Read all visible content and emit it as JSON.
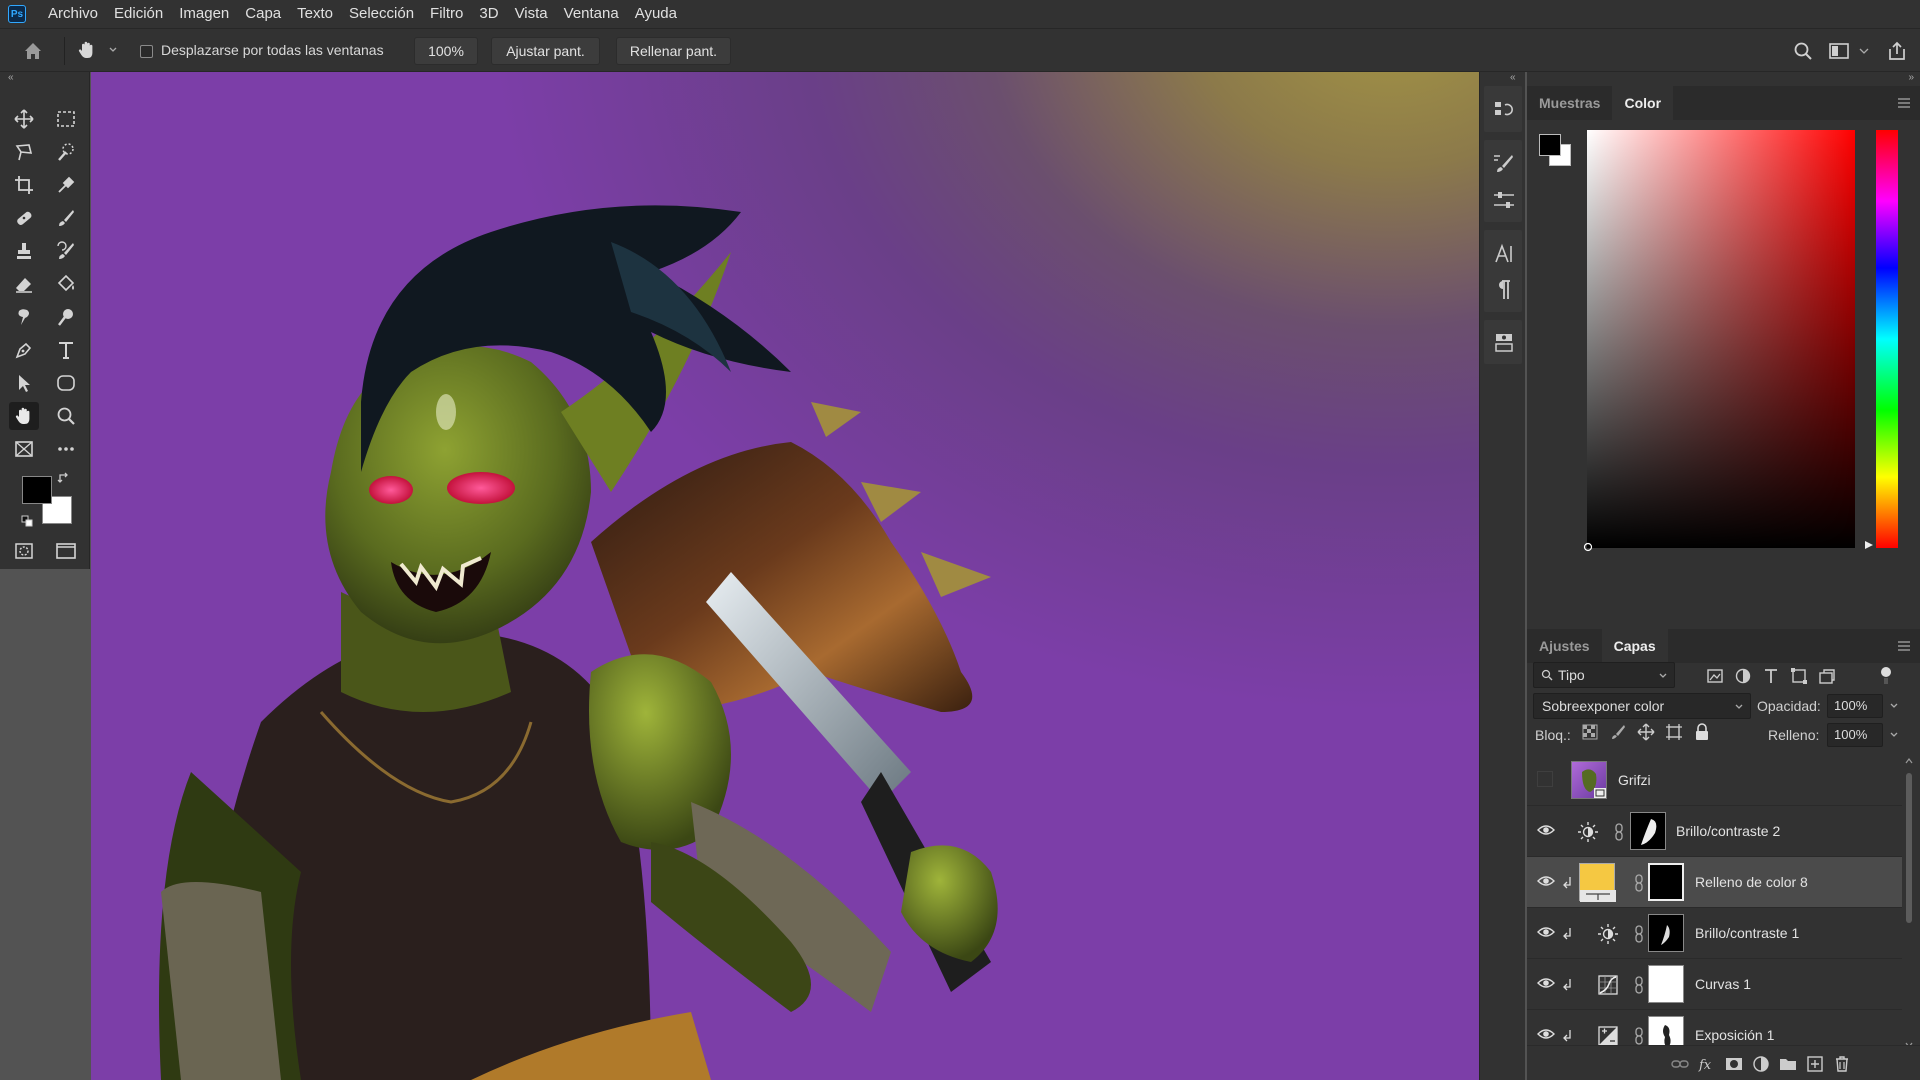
{
  "menu": {
    "items": [
      "Archivo",
      "Edición",
      "Imagen",
      "Capa",
      "Texto",
      "Selección",
      "Filtro",
      "3D",
      "Vista",
      "Ventana",
      "Ayuda"
    ]
  },
  "options": {
    "scroll_all_label": "Desplazarse por todas las ventanas",
    "scroll_all_checked": false,
    "zoom_value": "100%",
    "fit_screen": "Ajustar pant.",
    "fill_screen": "Rellenar pant."
  },
  "toolbar": {
    "active_tool": "hand-tool",
    "foreground_color": "#000000",
    "background_color": "#ffffff"
  },
  "color_panel": {
    "tabs": [
      "Muestras",
      "Color"
    ],
    "active_tab": "Color",
    "foreground": "#000000",
    "background": "#ffffff",
    "hue_color": "#ff0000"
  },
  "layers_panel": {
    "tabs": [
      "Ajustes",
      "Capas"
    ],
    "active_tab": "Capas",
    "filter": "Tipo",
    "blend_mode": "Sobreexponer color",
    "opacity_label": "Opacidad:",
    "opacity": "100%",
    "lock_label": "Bloq.:",
    "fill_label": "Relleno:",
    "fill": "100%",
    "layers": [
      {
        "name": "Grifzi",
        "visible": false,
        "type": "smart-object",
        "clipped": false,
        "selected": false
      },
      {
        "name": "Brillo/contraste 2",
        "visible": true,
        "type": "brightness-contrast",
        "clipped": false,
        "selected": false
      },
      {
        "name": "Relleno de color 8",
        "visible": true,
        "type": "color-fill",
        "clipped": true,
        "selected": true,
        "fill_color": "#f5c842"
      },
      {
        "name": "Brillo/contraste 1",
        "visible": true,
        "type": "brightness-contrast",
        "clipped": true,
        "selected": false
      },
      {
        "name": "Curvas 1",
        "visible": true,
        "type": "curves",
        "clipped": true,
        "selected": false
      },
      {
        "name": "Exposición 1",
        "visible": true,
        "type": "exposure",
        "clipped": true,
        "selected": false
      }
    ]
  }
}
